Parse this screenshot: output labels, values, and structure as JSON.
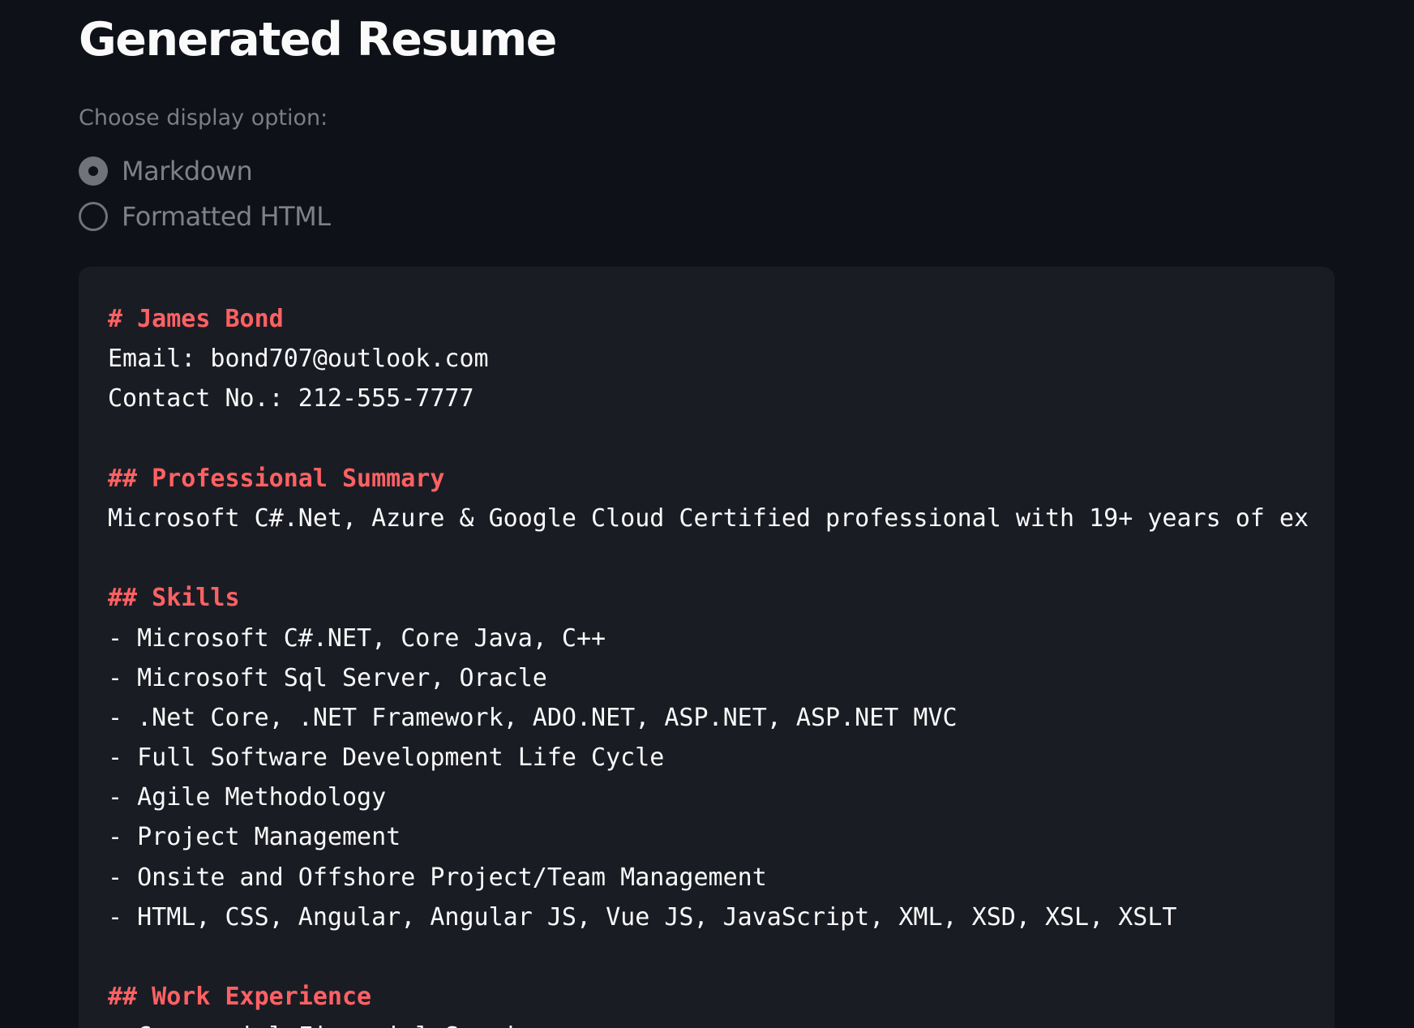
{
  "page": {
    "title": "Generated Resume"
  },
  "display_option": {
    "label": "Choose display option:",
    "options": [
      {
        "label": "Markdown",
        "selected": true
      },
      {
        "label": "Formatted HTML",
        "selected": false
      }
    ]
  },
  "markdown": {
    "lines": [
      {
        "text": "# James Bond",
        "heading": true
      },
      {
        "text": "Email: bond707@outlook.com",
        "heading": false
      },
      {
        "text": "Contact No.: 212-555-7777",
        "heading": false
      },
      {
        "text": "",
        "heading": false
      },
      {
        "text": "## Professional Summary",
        "heading": true
      },
      {
        "text": "Microsoft C#.Net, Azure & Google Cloud Certified professional with 19+ years of ex",
        "heading": false
      },
      {
        "text": "",
        "heading": false
      },
      {
        "text": "## Skills",
        "heading": true
      },
      {
        "text": "- Microsoft C#.NET, Core Java, C++",
        "heading": false
      },
      {
        "text": "- Microsoft Sql Server, Oracle",
        "heading": false
      },
      {
        "text": "- .Net Core, .NET Framework, ADO.NET, ASP.NET, ASP.NET MVC",
        "heading": false
      },
      {
        "text": "- Full Software Development Life Cycle",
        "heading": false
      },
      {
        "text": "- Agile Methodology",
        "heading": false
      },
      {
        "text": "- Project Management",
        "heading": false
      },
      {
        "text": "- Onsite and Offshore Project/Team Management",
        "heading": false
      },
      {
        "text": "- HTML, CSS, Angular, Angular JS, Vue JS, JavaScript, XML, XSD, XSL, XSLT",
        "heading": false
      },
      {
        "text": "",
        "heading": false
      },
      {
        "text": "## Work Experience",
        "heading": true
      },
      {
        "text": "- Commercial Financial Services",
        "heading": false
      }
    ]
  },
  "colors": {
    "background": "#0e1117",
    "code_background": "#1a1c24",
    "heading": "#ff6163",
    "text": "#fafafa",
    "muted": "#7b7e87"
  }
}
